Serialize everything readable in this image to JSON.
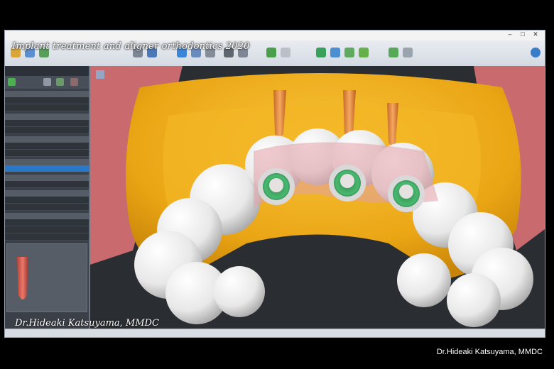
{
  "overlay": {
    "title": "Implant treatment and aligner orthodontics 2020",
    "watermark": "Dr.Hideaki Katsuyama, MMDC"
  },
  "credit": "Dr.Hideaki Katsuyama, MMDC",
  "colors": {
    "bone": "#f0b21a",
    "gingiva": "#d9757a",
    "teeth": "#ececec",
    "sleeve": "#3aa860",
    "implant": "#e8964a",
    "selection": "#2a78c8",
    "background": "#2a2d32"
  },
  "icons": [
    "add-icon",
    "tool-icon",
    "layers-icon",
    "close-icon",
    "undo-icon",
    "redo-icon",
    "eye-icon",
    "minimize-icon",
    "maximize-icon",
    "window-close-icon"
  ]
}
